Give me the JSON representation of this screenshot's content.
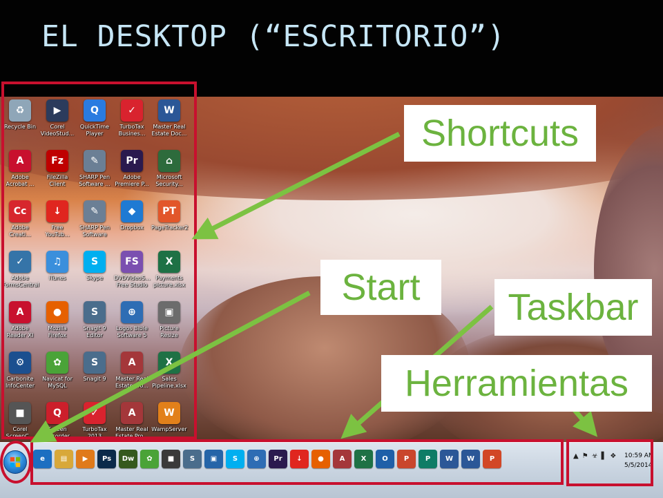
{
  "slide": {
    "title": "EL DESKTOP (“ESCRITORIO”)"
  },
  "callouts": {
    "shortcuts": "Shortcuts",
    "start": "Start",
    "taskbar": "Taskbar",
    "herramientas": "Herramientas"
  },
  "colors": {
    "callout_text": "#6cb33f",
    "arrow": "#7cc242",
    "highlight": "#c8102e",
    "title": "#c6e6f6"
  },
  "desktop_icons": [
    {
      "label": "Recycle Bin",
      "icon": "recycle-bin-icon",
      "glyph": "♻",
      "color": "#8fa6b8"
    },
    {
      "label": "Corel\nVideoStud...",
      "icon": "corel-videostudio-icon",
      "glyph": "▶",
      "color": "#2b3b5c"
    },
    {
      "label": "QuickTime\nPlayer",
      "icon": "quicktime-icon",
      "glyph": "Q",
      "color": "#2a7be0"
    },
    {
      "label": "TurboTax\nBusines...",
      "icon": "turbotax-icon",
      "glyph": "✓",
      "color": "#d9232e"
    },
    {
      "label": "Master Real\nEstate Doc...",
      "icon": "word-document-icon",
      "glyph": "W",
      "color": "#2b5797"
    },
    {
      "label": "Adobe\nAcrobat ...",
      "icon": "adobe-acrobat-icon",
      "glyph": "A",
      "color": "#c8102e"
    },
    {
      "label": "FileZilla\nClient",
      "icon": "filezilla-icon",
      "glyph": "Fz",
      "color": "#bf0000"
    },
    {
      "label": "SHARP Pen\nSoftware ...",
      "icon": "sharp-pen-icon",
      "glyph": "✎",
      "color": "#6b7f95"
    },
    {
      "label": "Adobe\nPremiere P...",
      "icon": "adobe-premiere-icon",
      "glyph": "Pr",
      "color": "#2a1a4e"
    },
    {
      "label": "Microsoft\nSecurity...",
      "icon": "microsoft-security-icon",
      "glyph": "⌂",
      "color": "#2d6b3c"
    },
    {
      "label": "Adobe\nCreati...",
      "icon": "adobe-creative-cloud-icon",
      "glyph": "Cc",
      "color": "#d7262d"
    },
    {
      "label": "Free\nYouTub...",
      "icon": "free-youtube-download-icon",
      "glyph": "↓",
      "color": "#e0261f"
    },
    {
      "label": "SHARP Pen\nSoftware",
      "icon": "sharp-pen-icon",
      "glyph": "✎",
      "color": "#6b7f95"
    },
    {
      "label": "Dropbox",
      "icon": "dropbox-icon",
      "glyph": "◆",
      "color": "#1f7ad3"
    },
    {
      "label": "PageTracker2",
      "icon": "pagetracker-icon",
      "glyph": "PT",
      "color": "#e2562a"
    },
    {
      "label": "Adobe\nFormsCentral",
      "icon": "adobe-formscentral-icon",
      "glyph": "✓",
      "color": "#3574a8"
    },
    {
      "label": "iTunes",
      "icon": "itunes-icon",
      "glyph": "♫",
      "color": "#3a8fdc"
    },
    {
      "label": "Skype",
      "icon": "skype-icon",
      "glyph": "S",
      "color": "#00aff0"
    },
    {
      "label": "DVDVideoS...\nFree Studio",
      "icon": "dvdvideosoft-icon",
      "glyph": "FS",
      "color": "#7b4fb0"
    },
    {
      "label": "Payments\npicture.xlsx",
      "icon": "excel-file-icon",
      "glyph": "X",
      "color": "#1e7145"
    },
    {
      "label": "Adobe\nReader XI",
      "icon": "adobe-reader-icon",
      "glyph": "A",
      "color": "#c8102e"
    },
    {
      "label": "Mozilla\nFirefox",
      "icon": "firefox-icon",
      "glyph": "●",
      "color": "#e66000"
    },
    {
      "label": "Snagit 9\nEditor",
      "icon": "snagit-editor-icon",
      "glyph": "S",
      "color": "#4a6d8c"
    },
    {
      "label": "Logos Bible\nSoftware 5",
      "icon": "logos-bible-icon",
      "glyph": "⊕",
      "color": "#2e6db4"
    },
    {
      "label": "Picture\nResize",
      "icon": "picture-resize-icon",
      "glyph": "▣",
      "color": "#6c6c6c"
    },
    {
      "label": "Carbonite\nInfoCenter",
      "icon": "carbonite-icon",
      "glyph": "⚙",
      "color": "#1b4f8f"
    },
    {
      "label": "Navicat for\nMySQL",
      "icon": "navicat-icon",
      "glyph": "✿",
      "color": "#4aa338"
    },
    {
      "label": "Snagit 9",
      "icon": "snagit-icon",
      "glyph": "S",
      "color": "#4a6d8c"
    },
    {
      "label": "Master Real\nEstate Pro...",
      "icon": "access-file-icon",
      "glyph": "A",
      "color": "#a4373a"
    },
    {
      "label": "Sales\nPipeline.xlsx",
      "icon": "excel-file-icon",
      "glyph": "X",
      "color": "#1e7145"
    },
    {
      "label": "Corel\nScreenC...",
      "icon": "corel-screencap-icon",
      "glyph": "■",
      "color": "#555555"
    },
    {
      "label": "Screen\nRecorder",
      "icon": "screen-recorder-icon",
      "glyph": "Q",
      "color": "#cc1f2b"
    },
    {
      "label": "TurboTax\n2013",
      "icon": "turbotax-icon",
      "glyph": "✓",
      "color": "#d9232e"
    },
    {
      "label": "Master Real\nEstate Pro...",
      "icon": "access-file-icon",
      "glyph": "A",
      "color": "#a4373a"
    },
    {
      "label": "WampServer",
      "icon": "wampserver-icon",
      "glyph": "W",
      "color": "#e2801a"
    }
  ],
  "taskbar": {
    "apps": [
      {
        "name": "internet-explorer",
        "glyph": "e",
        "color": "#1c6fc1"
      },
      {
        "name": "file-explorer",
        "glyph": "▤",
        "color": "#d8a83a"
      },
      {
        "name": "media-player",
        "glyph": "▶",
        "color": "#e07a1a"
      },
      {
        "name": "photoshop",
        "glyph": "Ps",
        "color": "#0b2a4a"
      },
      {
        "name": "dreamweaver",
        "glyph": "Dw",
        "color": "#35591d"
      },
      {
        "name": "navicat",
        "glyph": "✿",
        "color": "#4aa338"
      },
      {
        "name": "screen-capture",
        "glyph": "■",
        "color": "#3a3a3a"
      },
      {
        "name": "snagit",
        "glyph": "S",
        "color": "#4a6d8c"
      },
      {
        "name": "ftp",
        "glyph": "▣",
        "color": "#2565a8"
      },
      {
        "name": "skype",
        "glyph": "S",
        "color": "#00aff0"
      },
      {
        "name": "logos",
        "glyph": "⊕",
        "color": "#2e6db4"
      },
      {
        "name": "premiere",
        "glyph": "Pr",
        "color": "#2a1a4e"
      },
      {
        "name": "youtube-downloader",
        "glyph": "↓",
        "color": "#e0261f"
      },
      {
        "name": "firefox",
        "glyph": "●",
        "color": "#e66000"
      },
      {
        "name": "access",
        "glyph": "A",
        "color": "#a4373a"
      },
      {
        "name": "excel",
        "glyph": "X",
        "color": "#1e7145"
      },
      {
        "name": "outlook",
        "glyph": "O",
        "color": "#1f5fa8"
      },
      {
        "name": "powerpoint",
        "glyph": "P",
        "color": "#c9462c"
      },
      {
        "name": "publisher",
        "glyph": "P",
        "color": "#0f7c66"
      },
      {
        "name": "word",
        "glyph": "W",
        "color": "#2b5797"
      },
      {
        "name": "word-active",
        "glyph": "W",
        "color": "#2b5797"
      },
      {
        "name": "powerpoint-active",
        "glyph": "P",
        "color": "#d24726"
      }
    ],
    "tray_icons": [
      "▲",
      "⚑",
      "☣",
      "▌",
      "❖"
    ],
    "clock": {
      "time": "10:59 AM",
      "date": "5/5/2014"
    }
  }
}
